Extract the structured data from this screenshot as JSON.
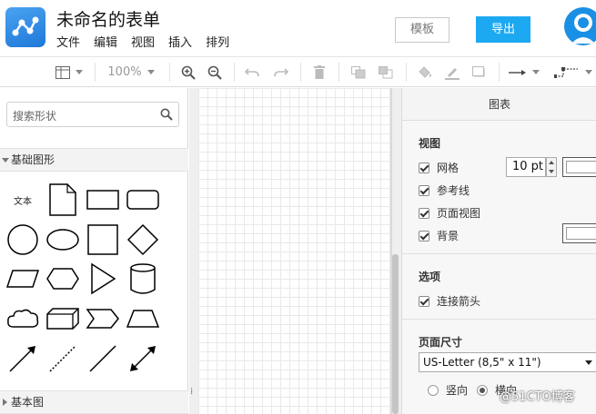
{
  "app": {
    "title": "未命名的表单",
    "menu": [
      "文件",
      "编辑",
      "视图",
      "插入",
      "排列"
    ],
    "template_button": "模板",
    "export_button": "导出",
    "accent_color": "#1ca9f2"
  },
  "toolbar": {
    "zoom": "100%"
  },
  "sidebar": {
    "search_placeholder": "搜索形状",
    "section_basic_shapes": "基础图形",
    "section_basic_diagram": "基本图",
    "text_shape_label": "文本"
  },
  "panel": {
    "tab": "图表",
    "view_heading": "视图",
    "grid": "网格",
    "grid_size": "10 pt",
    "guides": "参考线",
    "page_view": "页面视图",
    "background": "背景",
    "options_heading": "选项",
    "connection_arrows": "连接箭头",
    "page_size_heading": "页面尺寸",
    "page_size_value": "US-Letter (8,5\" x 11\")",
    "portrait": "竖向",
    "landscape": "横向"
  },
  "watermark": "@51CTO博客"
}
